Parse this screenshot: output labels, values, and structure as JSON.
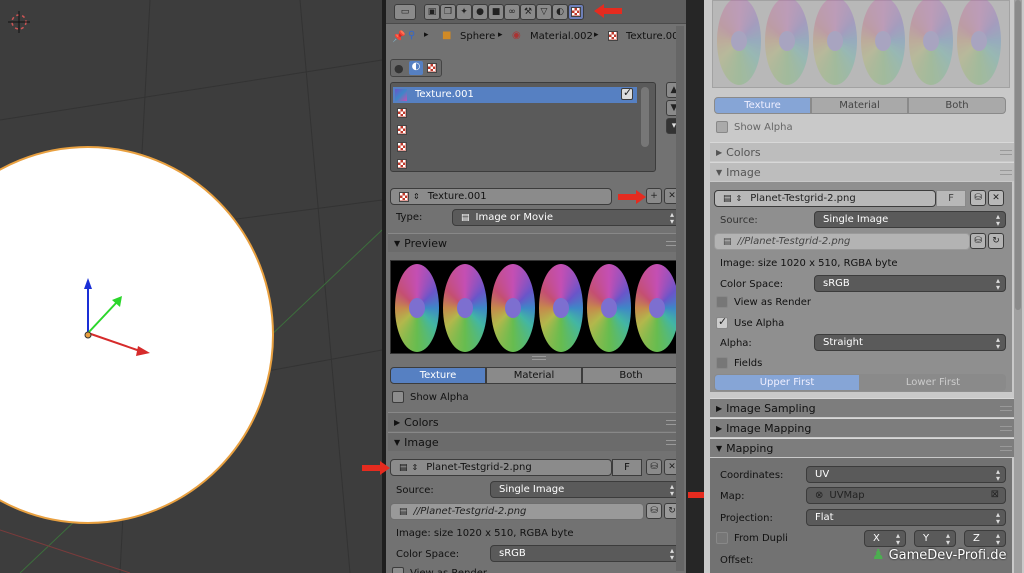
{
  "colors": {
    "viewport_bg": "#3d3d3d",
    "panel_bg": "#727272",
    "selected_blue": "#5680c2",
    "red_arrow": "#e52b1f"
  },
  "breadcrumb": {
    "object": "Sphere",
    "material": "Material.002",
    "texture": "Texture.001"
  },
  "texture_list": {
    "selected": "Texture.001"
  },
  "texture_block": {
    "name": "Texture.001",
    "type_label": "Type:",
    "type_value": "Image or Movie"
  },
  "sections": {
    "preview": "Preview",
    "colors": "Colors",
    "image": "Image",
    "image_sampling": "Image Sampling",
    "image_mapping": "Image Mapping",
    "mapping": "Mapping"
  },
  "preview_tabs": [
    "Texture",
    "Material",
    "Both"
  ],
  "show_alpha": "Show Alpha",
  "image": {
    "name": "Planet-Testgrid-2.png",
    "f_label": "F",
    "source_label": "Source:",
    "source_value": "Single Image",
    "path": "//Planet-Testgrid-2.png",
    "info": "Image: size 1020 x 510, RGBA byte",
    "colorspace_label": "Color Space:",
    "colorspace_value": "sRGB",
    "view_as_render": "View as Render",
    "use_alpha": "Use Alpha",
    "alpha_label": "Alpha:",
    "alpha_value": "Straight",
    "fields": "Fields",
    "upper_first": "Upper First",
    "lower_first": "Lower First"
  },
  "mapping": {
    "coordinates_label": "Coordinates:",
    "coordinates_value": "UV",
    "map_label": "Map:",
    "map_value": "UVMap",
    "projection_label": "Projection:",
    "projection_value": "Flat",
    "from_dupli": "From Dupli",
    "x": "X",
    "y": "Y",
    "z": "Z",
    "offset_label": "Offset:"
  },
  "watermark": "GameDev-Profi.de"
}
